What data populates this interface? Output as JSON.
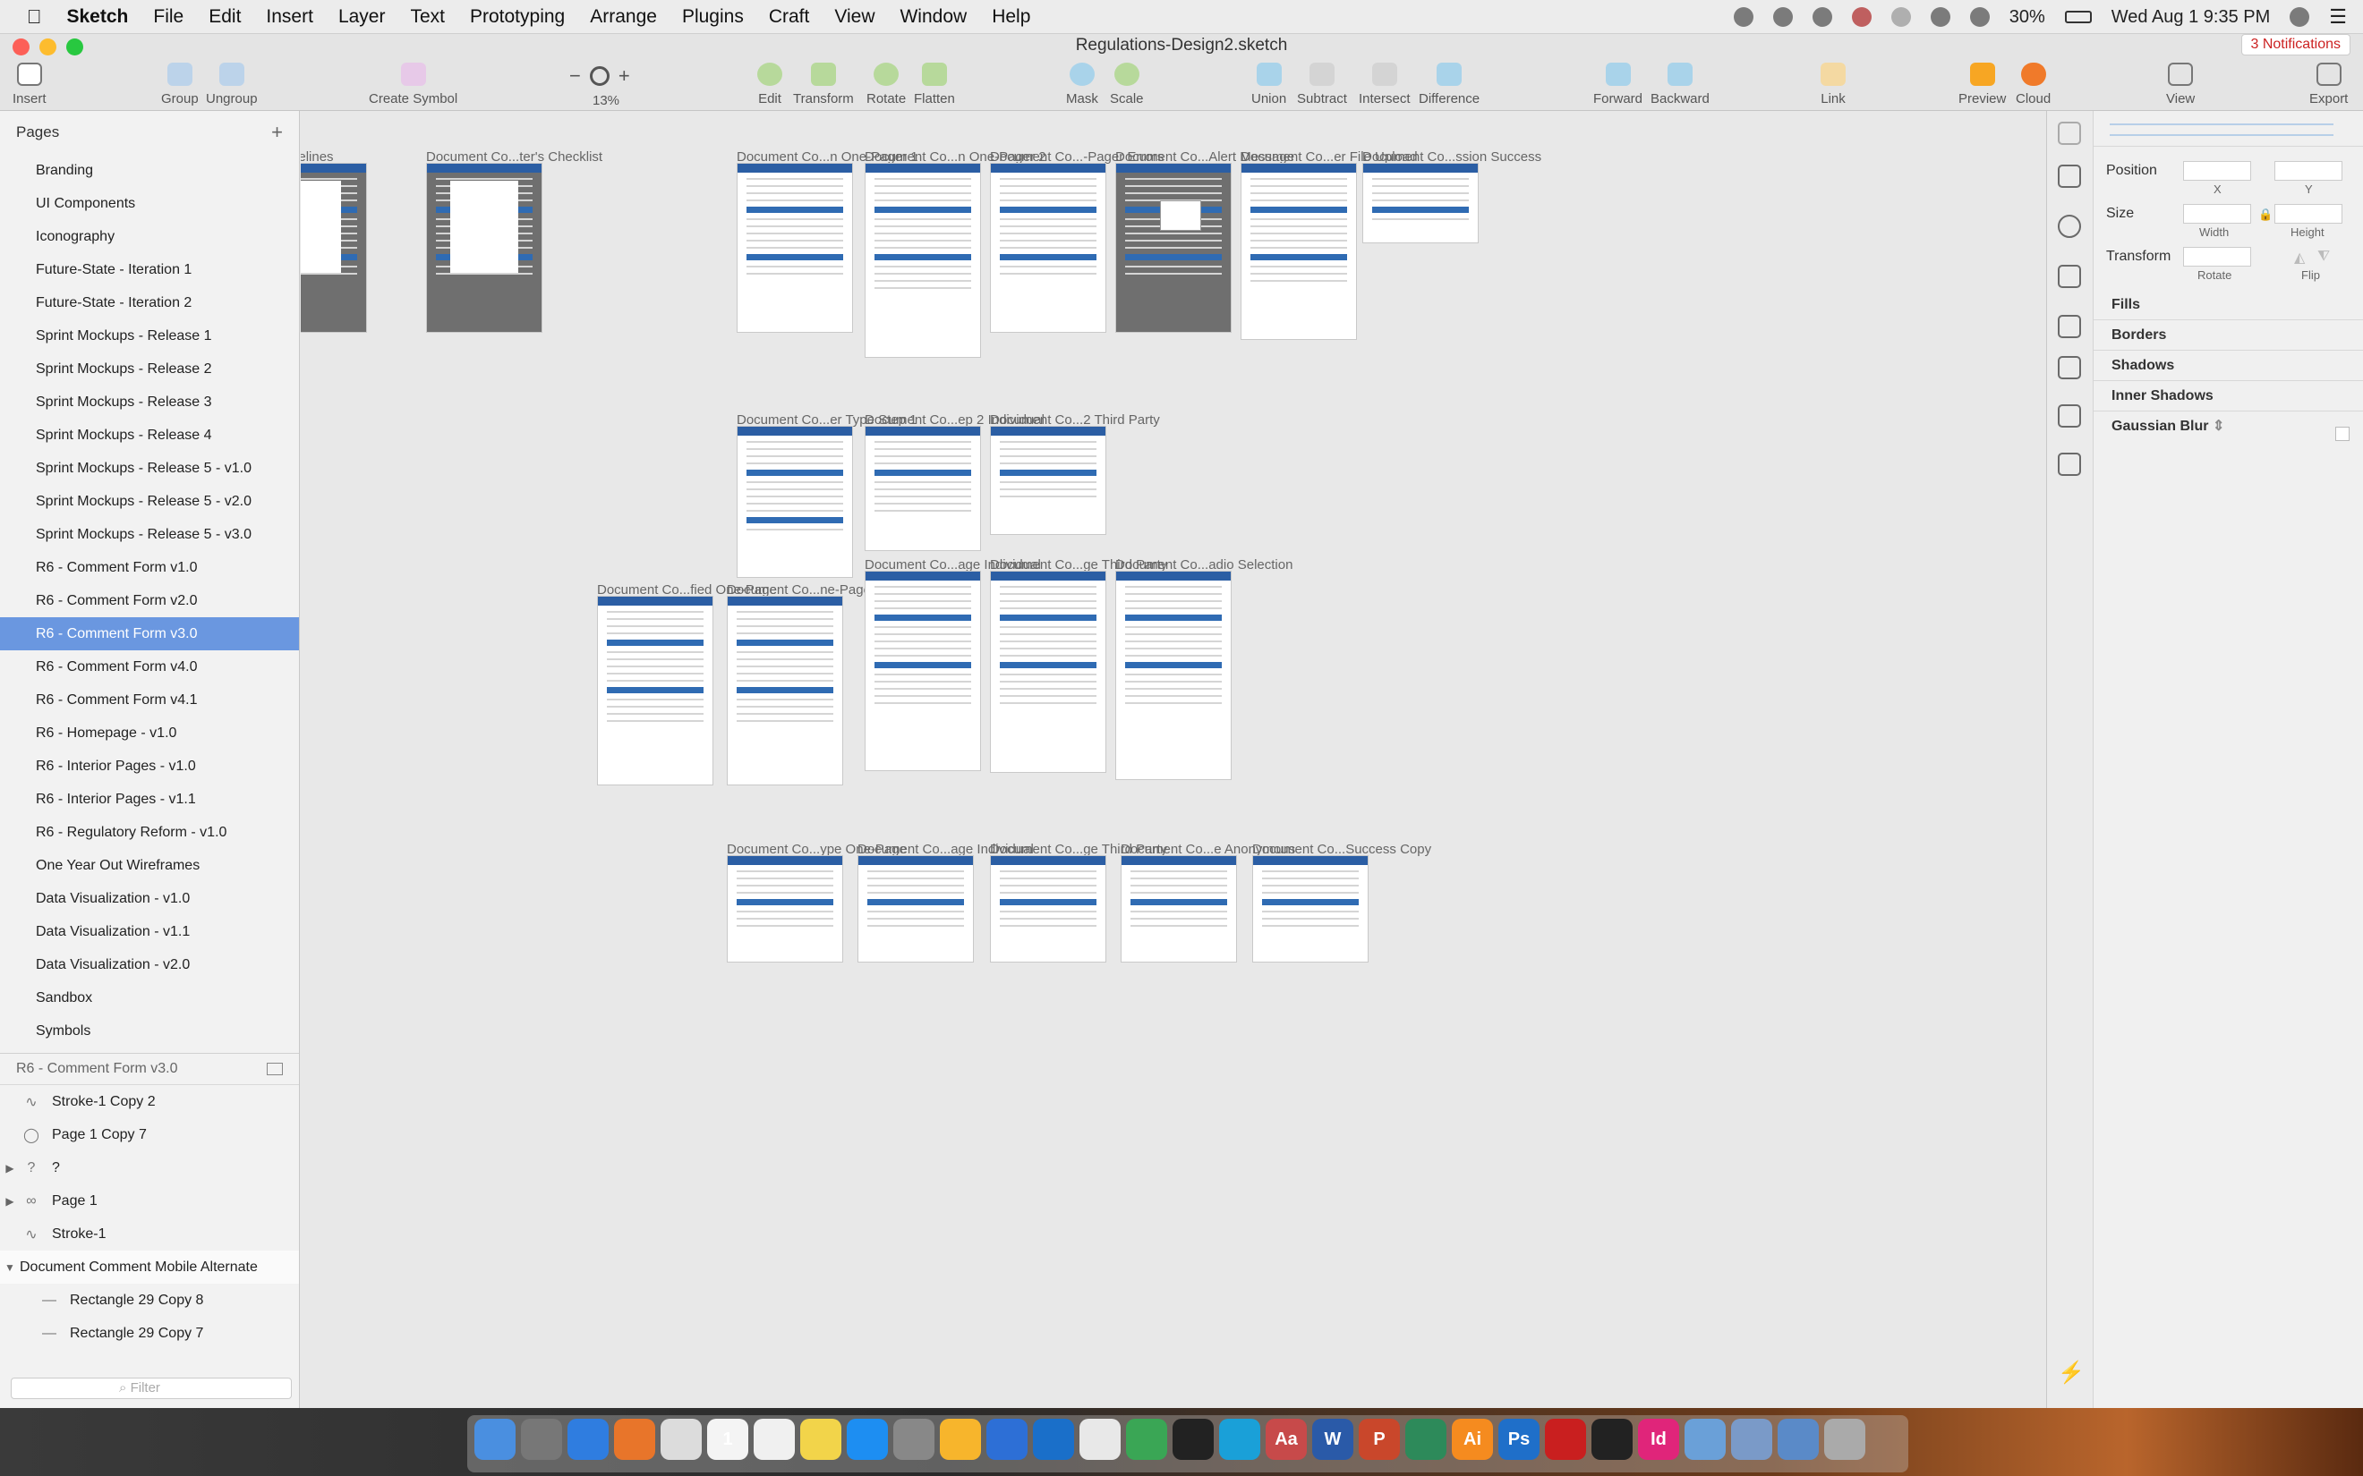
{
  "menubar": {
    "apple": "",
    "app": "Sketch",
    "menus": [
      "File",
      "Edit",
      "Insert",
      "Layer",
      "Text",
      "Prototyping",
      "Arrange",
      "Plugins",
      "Craft",
      "View",
      "Window",
      "Help"
    ],
    "battery": "30%",
    "clock": "Wed Aug 1  9:35 PM"
  },
  "window": {
    "title": "Regulations-Design2.sketch",
    "notifications": "3 Notifications"
  },
  "toolbar": {
    "insert": "Insert",
    "group": "Group",
    "ungroup": "Ungroup",
    "create_symbol": "Create Symbol",
    "zoom_out": "−",
    "zoom_in": "+",
    "zoom": "13%",
    "edit": "Edit",
    "transform": "Transform",
    "rotate": "Rotate",
    "flatten": "Flatten",
    "mask": "Mask",
    "scale": "Scale",
    "union": "Union",
    "subtract": "Subtract",
    "intersect": "Intersect",
    "difference": "Difference",
    "forward": "Forward",
    "backward": "Backward",
    "link": "Link",
    "preview": "Preview",
    "cloud": "Cloud",
    "view": "View",
    "export": "Export"
  },
  "pages": {
    "header": "Pages",
    "add": "+",
    "items": [
      "Branding",
      "UI Components",
      "Iconography",
      "Future-State - Iteration 1",
      "Future-State - Iteration 2",
      "Sprint Mockups - Release 1",
      "Sprint Mockups - Release 2",
      "Sprint Mockups - Release 3",
      "Sprint Mockups - Release 4",
      "Sprint Mockups - Release 5 - v1.0",
      "Sprint Mockups - Release 5 - v2.0",
      "Sprint Mockups - Release 5 - v3.0",
      "R6 - Comment Form v1.0",
      "R6 - Comment Form v2.0",
      "R6 - Comment Form v3.0",
      "R6 - Comment Form v4.0",
      "R6 - Comment Form v4.1",
      "R6 - Homepage - v1.0",
      "R6 - Interior Pages - v1.0",
      "R6 - Interior Pages - v1.1",
      "R6 - Regulatory Reform - v1.0",
      "One Year Out Wireframes",
      "Data Visualization - v1.0",
      "Data Visualization - v1.1",
      "Data Visualization - v2.0",
      "Sandbox",
      "Symbols"
    ],
    "selected": "R6 - Comment Form v3.0"
  },
  "layers": {
    "header": "R6 - Comment Form v3.0",
    "items": [
      {
        "name": "Stroke-1 Copy 2",
        "icon": "∿",
        "tri": ""
      },
      {
        "name": "Page 1 Copy 7",
        "icon": "◯",
        "tri": ""
      },
      {
        "name": "?",
        "icon": "?",
        "tri": "▶"
      },
      {
        "name": "Page 1",
        "icon": "∞",
        "tri": "▶"
      },
      {
        "name": "Stroke-1",
        "icon": "∿",
        "tri": ""
      },
      {
        "name": "Document Comment Mobile Alternate",
        "icon": "",
        "tri": "▼"
      },
      {
        "name": "Rectangle 29 Copy 8",
        "icon": "—",
        "tri": ""
      },
      {
        "name": "Rectangle 29 Copy 7",
        "icon": "—",
        "tri": ""
      }
    ],
    "filter": "Filter"
  },
  "artboards": [
    "...cy Guidelines",
    "Document Co...ter's Checklist",
    "Document Co...n One-Pager 1",
    "Document Co...n One-Pager 2",
    "Document Co...-Pager Errors",
    "Document Co...Alert Message",
    "Document Co...er File Upload",
    "Document Co...ssion Success",
    "Document Co...er Type Step 1",
    "Document Co...ep 2 Individual",
    "Document Co...2 Third Party",
    "Document Co...fied One-Page",
    "Document Co...ne-Page Copy",
    "Document Co...age Individual",
    "Document Co...ge Third Party",
    "Document Co...adio Selection",
    "Document Co...ype One-Page",
    "Document Co...age Individual",
    "Document Co...ge Third Party",
    "Document Co...e Anonymous",
    "Document Co...Success Copy"
  ],
  "inspector": {
    "position": "Position",
    "x": "X",
    "y": "Y",
    "size": "Size",
    "width": "Width",
    "height": "Height",
    "transform": "Transform",
    "rotate": "Rotate",
    "flip": "Flip",
    "fills": "Fills",
    "borders": "Borders",
    "shadows": "Shadows",
    "inner_shadows": "Inner Shadows",
    "gaussian_blur": "Gaussian Blur"
  },
  "dock": {
    "items": [
      "finder-icon",
      "launchpad-icon",
      "safari-icon",
      "firefox-icon",
      "chrome-icon",
      "calendar-icon",
      "textedit-icon",
      "stickies-icon",
      "app-store-icon",
      "system-preferences-icon",
      "sketch-icon",
      "maps-icon",
      "outlook-icon",
      "slack-icon",
      "atom-icon",
      "figma-icon",
      "libreoffice-icon",
      "dictionary-icon",
      "word-icon",
      "powerpoint-icon",
      "vpn-icon",
      "illustrator-icon",
      "photoshop-icon",
      "acrobat-icon",
      "terminal-icon",
      "indesign-icon",
      "folder-icon",
      "documents-icon",
      "downloads-icon",
      "trash-icon"
    ],
    "glyphs": {
      "illustrator": "Ai",
      "photoshop": "Ps",
      "indesign": "Id",
      "word": "W",
      "powerpoint": "P",
      "dictionary": "Aa",
      "calendar": "1"
    }
  },
  "colors": {
    "accent": "#6a97e0",
    "header_blue": "#2b5ea4",
    "notif_red": "#cc2222"
  }
}
